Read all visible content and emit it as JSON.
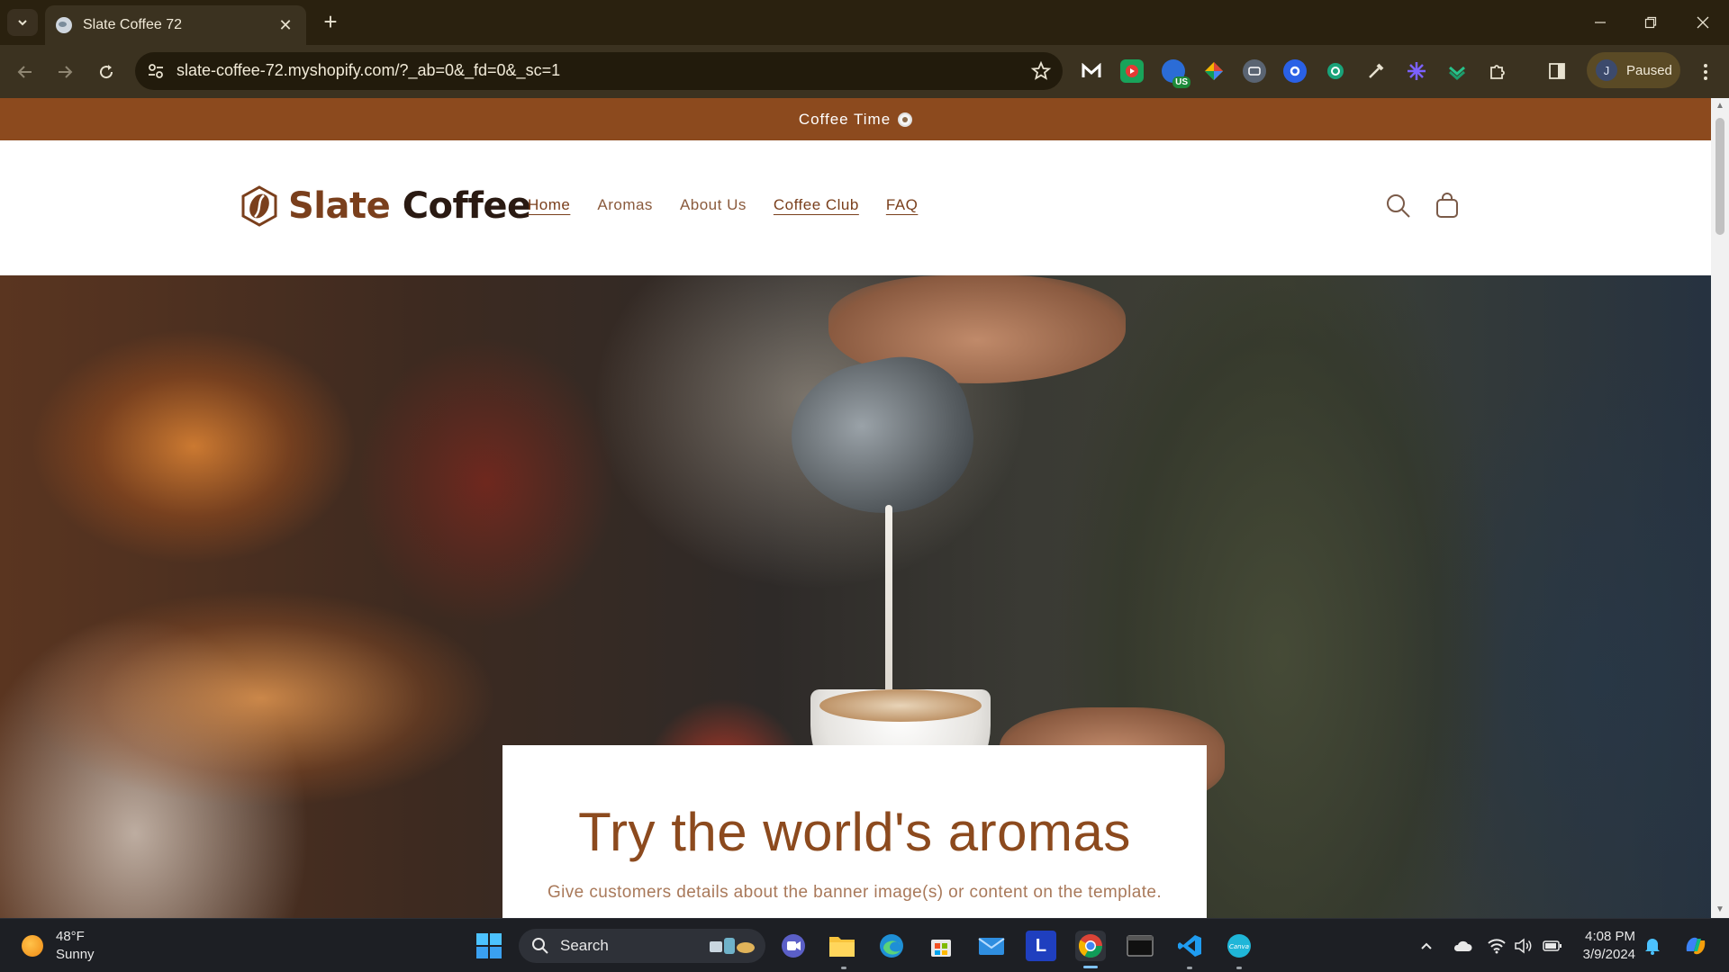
{
  "browser": {
    "tab_title": "Slate Coffee 72",
    "url": "slate-coffee-72.myshopify.com/?_ab=0&_fd=0&_sc=1",
    "profile_initial": "J",
    "profile_status": "Paused",
    "ext_badge": "US"
  },
  "store": {
    "announcement": "Coffee Time",
    "logo_part1": "Slate",
    "logo_part2": "Coffee",
    "nav": [
      {
        "label": "Home"
      },
      {
        "label": "Aromas"
      },
      {
        "label": "About Us"
      },
      {
        "label": "Coffee Club"
      },
      {
        "label": "FAQ"
      }
    ],
    "hero": {
      "heading": "Try the world's aromas",
      "subheading": "Give customers details about the banner image(s) or content on the template."
    }
  },
  "colors": {
    "announcement_bg": "#8c4a1e",
    "brand_brown": "#7a3f1c",
    "heading_brown": "#8c4a1e",
    "nav_text": "#8a5a3c"
  },
  "taskbar": {
    "weather_temp": "48°F",
    "weather_desc": "Sunny",
    "search_label": "Search",
    "time": "4:08 PM",
    "date": "3/9/2024",
    "l_app_letter": "L",
    "canva_label": "Canva"
  }
}
